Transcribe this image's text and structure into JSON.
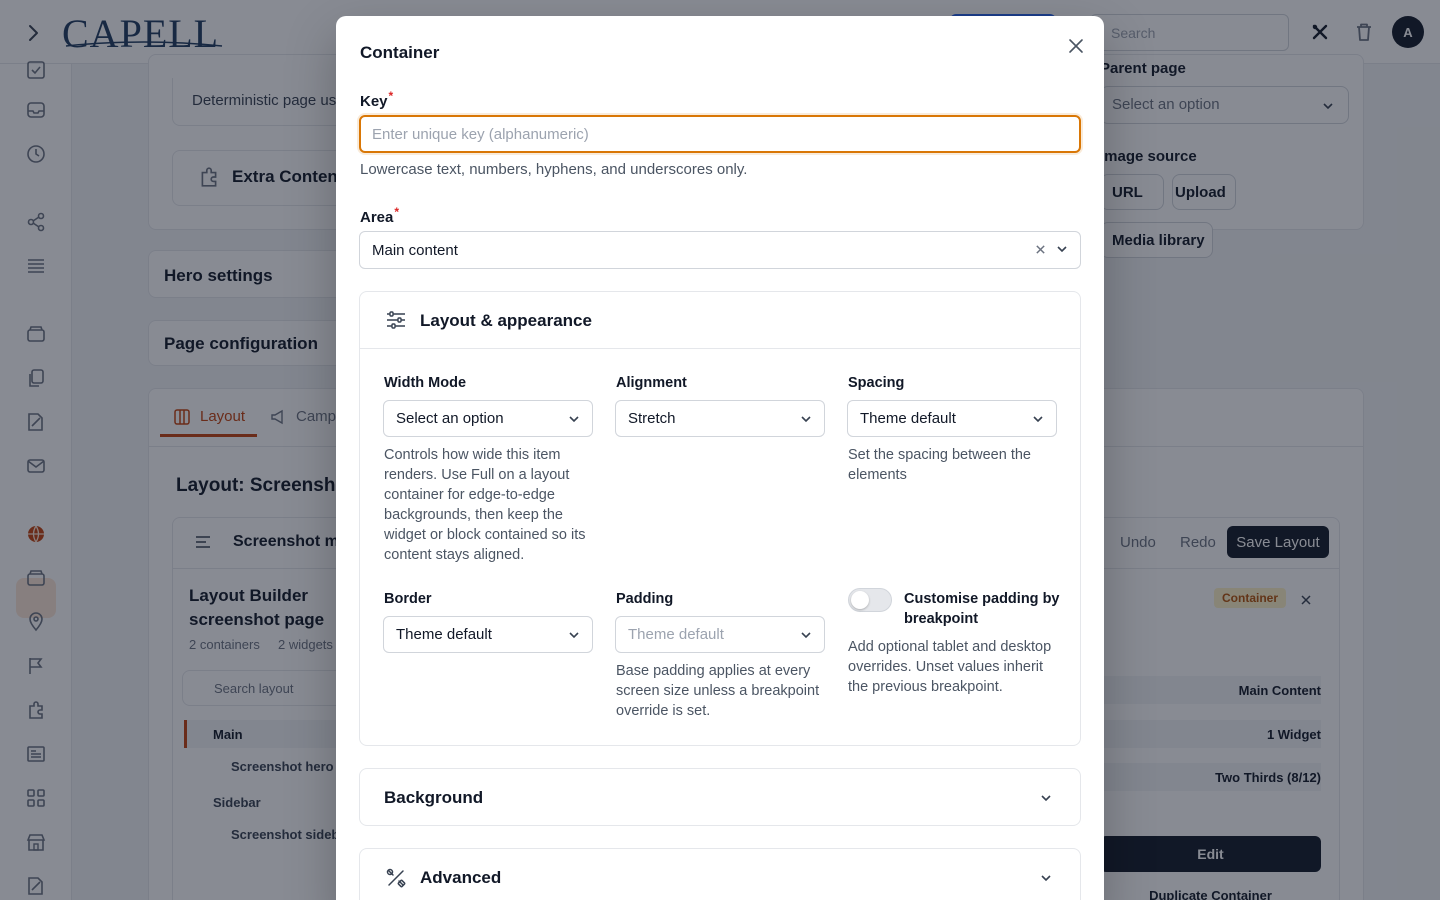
{
  "app": {
    "logo": "CAPELL",
    "search_placeholder": "Search",
    "avatar_initial": "A"
  },
  "background": {
    "parent_page_label": "Parent page",
    "parent_page_value": "Select an option",
    "image_source_label": "Image source",
    "image_source_buttons": [
      "URL",
      "Upload",
      "Media library"
    ],
    "deterministic_text": "Deterministic page us",
    "extra_content": "Extra Content",
    "hero_settings": "Hero settings",
    "page_configuration": "Page configuration",
    "tabs": [
      "Layout",
      "Camp"
    ],
    "layout_heading": "Layout: Screensho",
    "builder_title": "Screenshot m",
    "undo": "Undo",
    "redo": "Redo",
    "save_layout": "Save Layout",
    "builder_page_title_line1": "Layout Builder",
    "builder_page_title_line2": "screenshot page",
    "containers_count": "2 containers",
    "widgets_count": "2 widgets",
    "search_layout": "Search layout",
    "tree": [
      "Main",
      "Screenshot hero",
      "Sidebar",
      "Screenshot sideb"
    ],
    "container_badge": "Container",
    "props": [
      "Main Content",
      "1 Widget",
      "Two Thirds (8/12)"
    ],
    "edit": "Edit",
    "duplicate": "Duplicate Container"
  },
  "modal": {
    "title": "Container",
    "key": {
      "label": "Key",
      "required_mark": "*",
      "placeholder": "Enter unique key (alphanumeric)",
      "value": "",
      "hint": "Lowercase text, numbers, hyphens, and underscores only."
    },
    "area": {
      "label": "Area",
      "required_mark": "*",
      "value": "Main content"
    },
    "layout_section": {
      "title": "Layout & appearance",
      "width_mode": {
        "label": "Width Mode",
        "value": "Select an option",
        "hint": "Controls how wide this item renders. Use Full on a layout container for edge-to-edge backgrounds, then keep the widget or block contained so its content stays aligned."
      },
      "alignment": {
        "label": "Alignment",
        "value": "Stretch"
      },
      "spacing": {
        "label": "Spacing",
        "value": "Theme default",
        "hint": "Set the spacing between the elements"
      },
      "border": {
        "label": "Border",
        "value": "Theme default"
      },
      "padding": {
        "label": "Padding",
        "placeholder": "Theme default",
        "hint": "Base padding applies at every screen size unless a breakpoint override is set."
      },
      "breakpoint_toggle": {
        "label": "Customise padding by breakpoint",
        "enabled": false,
        "hint": "Add optional tablet and desktop overrides. Unset values inherit the previous breakpoint."
      }
    },
    "background_section": {
      "title": "Background"
    },
    "advanced_section": {
      "title": "Advanced"
    }
  }
}
